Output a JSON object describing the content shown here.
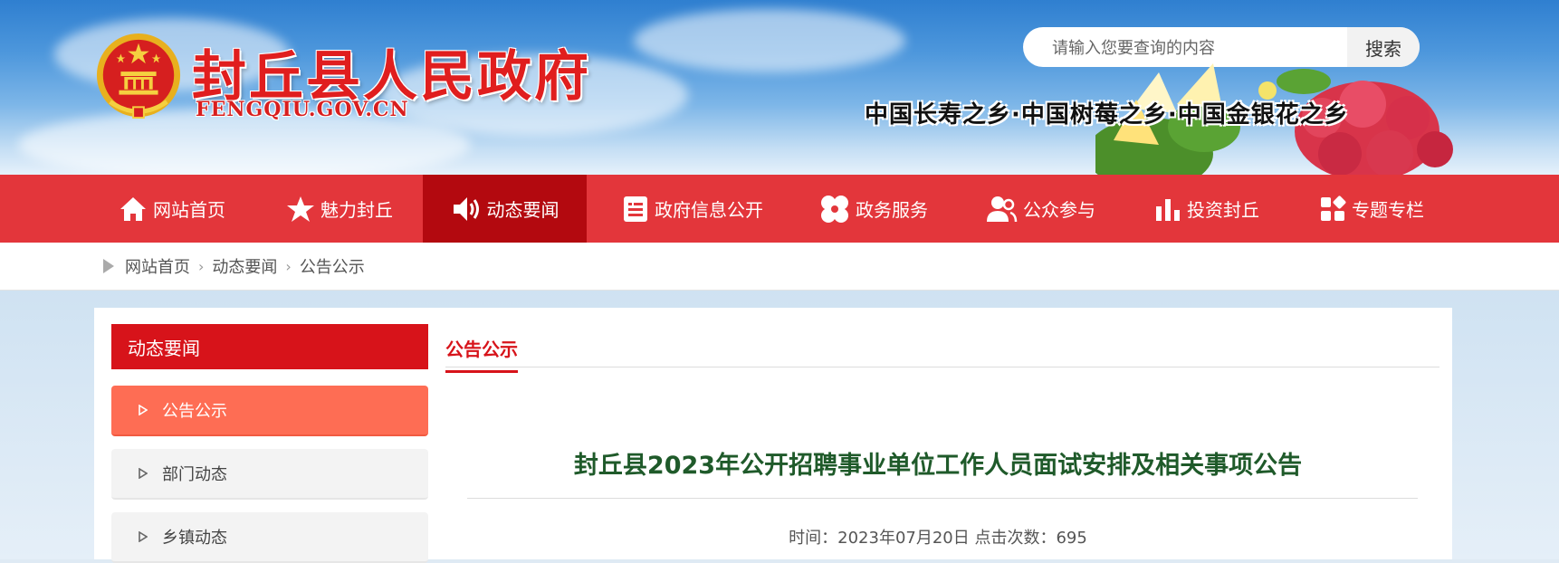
{
  "site": {
    "title": "封丘县人民政府",
    "domain": "FENGQIU.GOV.CN",
    "slogan": "中国长寿之乡·中国树莓之乡·中国金银花之乡"
  },
  "search": {
    "placeholder": "请输入您要查询的内容",
    "button_label": "搜索"
  },
  "nav": {
    "items": [
      {
        "label": "网站首页",
        "icon": "home-icon"
      },
      {
        "label": "魅力封丘",
        "icon": "star-icon"
      },
      {
        "label": "动态要闻",
        "icon": "speaker-icon",
        "active": true
      },
      {
        "label": "政府信息公开",
        "icon": "document-icon"
      },
      {
        "label": "政务服务",
        "icon": "service-icon"
      },
      {
        "label": "公众参与",
        "icon": "people-icon"
      },
      {
        "label": "投资封丘",
        "icon": "bar-chart-icon"
      },
      {
        "label": "专题专栏",
        "icon": "grid-icon"
      }
    ]
  },
  "breadcrumb": {
    "items": [
      "网站首页",
      "动态要闻",
      "公告公示"
    ]
  },
  "sidebar": {
    "heading": "动态要闻",
    "items": [
      {
        "label": "公告公示",
        "active": true
      },
      {
        "label": "部门动态"
      },
      {
        "label": "乡镇动态"
      }
    ]
  },
  "main": {
    "tab": "公告公示",
    "article_title": "封丘县2023年公开招聘事业单位工作人员面试安排及相关事项公告",
    "meta": "时间：2023年07月20日 点击次数：695"
  },
  "colors": {
    "nav_bg": "#e3363b",
    "nav_active": "#b3090f",
    "sidebar_head": "#d7131a",
    "sidebar_active": "#fe6d54",
    "title_green": "#1f5a2a"
  }
}
